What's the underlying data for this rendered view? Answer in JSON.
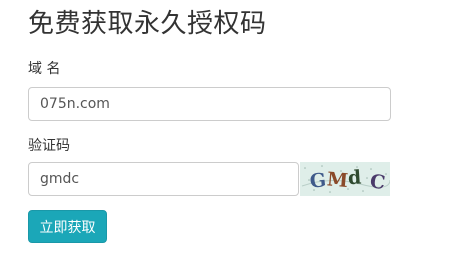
{
  "page": {
    "title": "免费获取永久授权码"
  },
  "form": {
    "domain_label": "域 名",
    "domain_value": "075n.com",
    "captcha_label": "验证码",
    "captcha_value": "gmdc",
    "captcha_image_text": "GMdC",
    "submit_label": "立即获取"
  },
  "colors": {
    "accent": "#1ba7b8",
    "input_border": "#cccccc",
    "captcha_bg": "#dfeee9"
  }
}
